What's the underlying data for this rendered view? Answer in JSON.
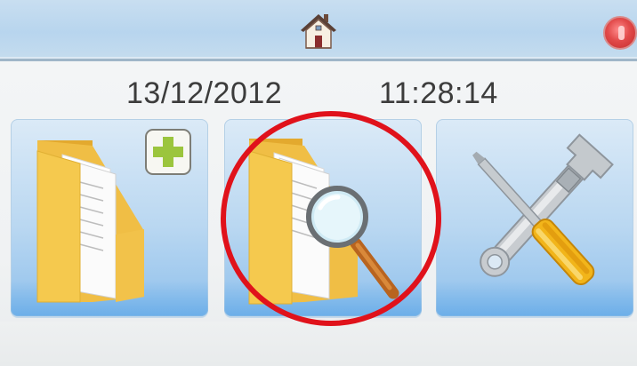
{
  "header": {
    "home_icon": "house-icon",
    "power_icon": "power-icon"
  },
  "status": {
    "date": "13/12/2012",
    "time": "11:28:14"
  },
  "tiles": [
    {
      "name": "new-folder",
      "icon": "folder-add-icon"
    },
    {
      "name": "search-folder",
      "icon": "folder-search-icon"
    },
    {
      "name": "settings-tools",
      "icon": "wrench-screwdriver-icon"
    }
  ],
  "colors": {
    "topbar": "#c2dbef",
    "tile_gradient_bottom": "#8fc0ec",
    "folder_yellow": "#f3c64a",
    "plus_green": "#9bc53d",
    "highlight_red": "#e0121b",
    "power_red": "#e24a4a"
  }
}
